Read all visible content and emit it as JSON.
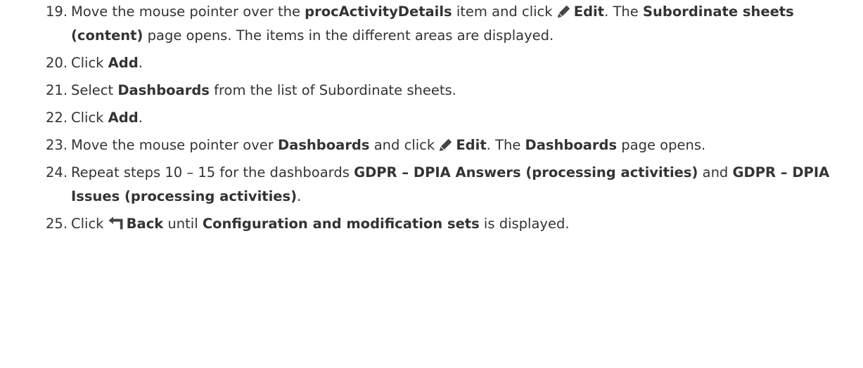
{
  "steps": [
    {
      "number": "19.",
      "parts": [
        {
          "t": "Move the mouse pointer over the "
        },
        {
          "t": "procActivityDetails",
          "b": true
        },
        {
          "t": " item and click "
        },
        {
          "icon": "pencil-icon"
        },
        {
          "t": "Edit",
          "b": true
        },
        {
          "t": ". The "
        },
        {
          "t": "Subordinate sheets (content)",
          "b": true
        },
        {
          "t": " page opens. The items in the different areas are displayed."
        }
      ]
    },
    {
      "number": "20.",
      "parts": [
        {
          "t": "Click "
        },
        {
          "t": "Add",
          "b": true
        },
        {
          "t": "."
        }
      ]
    },
    {
      "number": "21.",
      "parts": [
        {
          "t": "Select "
        },
        {
          "t": "Dashboards",
          "b": true
        },
        {
          "t": " from the list of Subordinate sheets."
        }
      ]
    },
    {
      "number": "22.",
      "parts": [
        {
          "t": "Click "
        },
        {
          "t": "Add",
          "b": true
        },
        {
          "t": "."
        }
      ]
    },
    {
      "number": "23.",
      "parts": [
        {
          "t": "Move the mouse pointer over "
        },
        {
          "t": "Dashboards",
          "b": true
        },
        {
          "t": " and click "
        },
        {
          "icon": "pencil-icon"
        },
        {
          "t": "Edit",
          "b": true
        },
        {
          "t": ". The "
        },
        {
          "t": "Dashboards",
          "b": true
        },
        {
          "t": " page opens."
        }
      ]
    },
    {
      "number": "24.",
      "parts": [
        {
          "t": "Repeat steps 10 – 15 for the dashboards "
        },
        {
          "t": "GDPR – DPIA Answers (processing activities)",
          "b": true
        },
        {
          "t": " and "
        },
        {
          "t": "GDPR – DPIA Issues (processing activities)",
          "b": true
        },
        {
          "t": "."
        }
      ]
    },
    {
      "number": "25.",
      "parts": [
        {
          "t": "Click "
        },
        {
          "icon": "back-arrow-icon"
        },
        {
          "t": "Back",
          "b": true
        },
        {
          "t": " until "
        },
        {
          "t": "Configuration and modification sets",
          "b": true
        },
        {
          "t": " is displayed."
        }
      ]
    }
  ]
}
